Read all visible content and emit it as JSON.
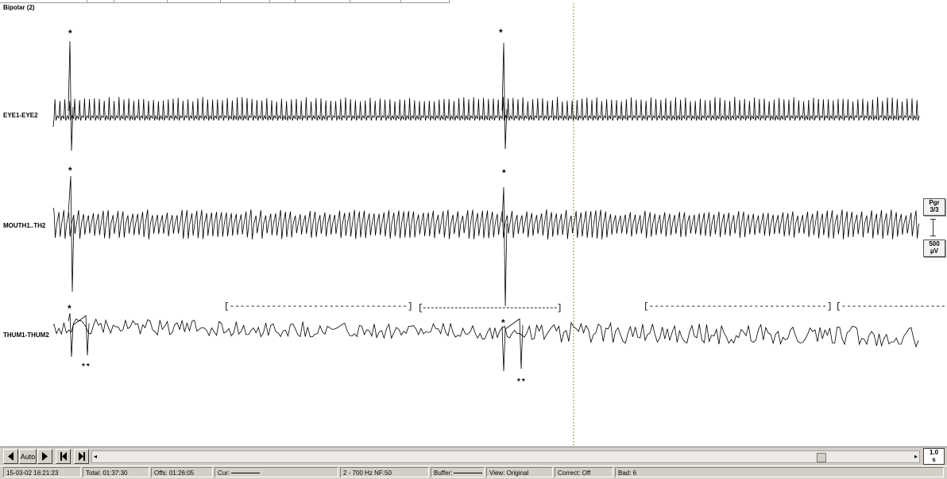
{
  "montage": {
    "title": "Bipolar (2)"
  },
  "channels": [
    {
      "label": "EYE1-EYE2"
    },
    {
      "label": "MOUTH1..TH2"
    },
    {
      "label": "THUM1-THUM2"
    }
  ],
  "annotations": {
    "single": "*",
    "double": "**",
    "segment": "[----------------------------------]",
    "segment_open": "[-------------------------"
  },
  "scale": {
    "page_line1": "Pgr",
    "page_line2": "3/3",
    "amp_value": "500",
    "amp_unit": "µV"
  },
  "toolbar": {
    "auto_label": "Auto",
    "speed_value": "1.0",
    "speed_unit": "s",
    "icons": [
      "step-back-icon",
      "play-icon",
      "skip-back-icon",
      "skip-forward-icon"
    ]
  },
  "status": {
    "datetime": "15-03-02  16:21:23",
    "total": "Total: 01:37:30",
    "offset": "Offs: 01:26:05",
    "cursor": "Cur:",
    "filter": "2 - 700 Hz  NF:50",
    "buffer": "Buffer:",
    "view": "View: Original",
    "correct": "Correct: Off",
    "bad": "Bad: 6"
  },
  "colors": {
    "background": "#ffffff",
    "trace": "#000000",
    "cursor_line": "#9c8a3a",
    "panel": "#d4d0c8"
  }
}
